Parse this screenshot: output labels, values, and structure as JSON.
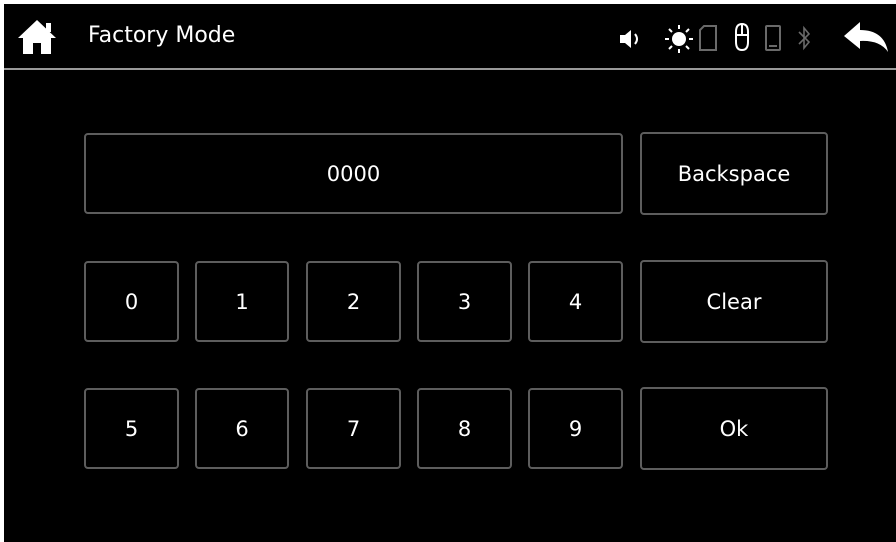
{
  "titlebar": {
    "title": "Factory Mode",
    "home_icon": "home-icon",
    "back_icon": "back-arrow-icon",
    "status_icons": [
      "volume-icon",
      "brightness-icon",
      "sd-card-icon",
      "usb-mouse-icon",
      "phone-icon",
      "bluetooth-icon"
    ]
  },
  "keypad": {
    "display_value": "0000",
    "digits_row1": [
      "0",
      "1",
      "2",
      "3",
      "4"
    ],
    "digits_row2": [
      "5",
      "6",
      "7",
      "8",
      "9"
    ],
    "backspace_label": "Backspace",
    "clear_label": "Clear",
    "ok_label": "Ok"
  },
  "colors": {
    "background": "#000000",
    "text": "#ffffff",
    "button_border": "#5d5d5d",
    "divider": "#9a9a9a",
    "inactive_icon": "#6a6a6a"
  }
}
